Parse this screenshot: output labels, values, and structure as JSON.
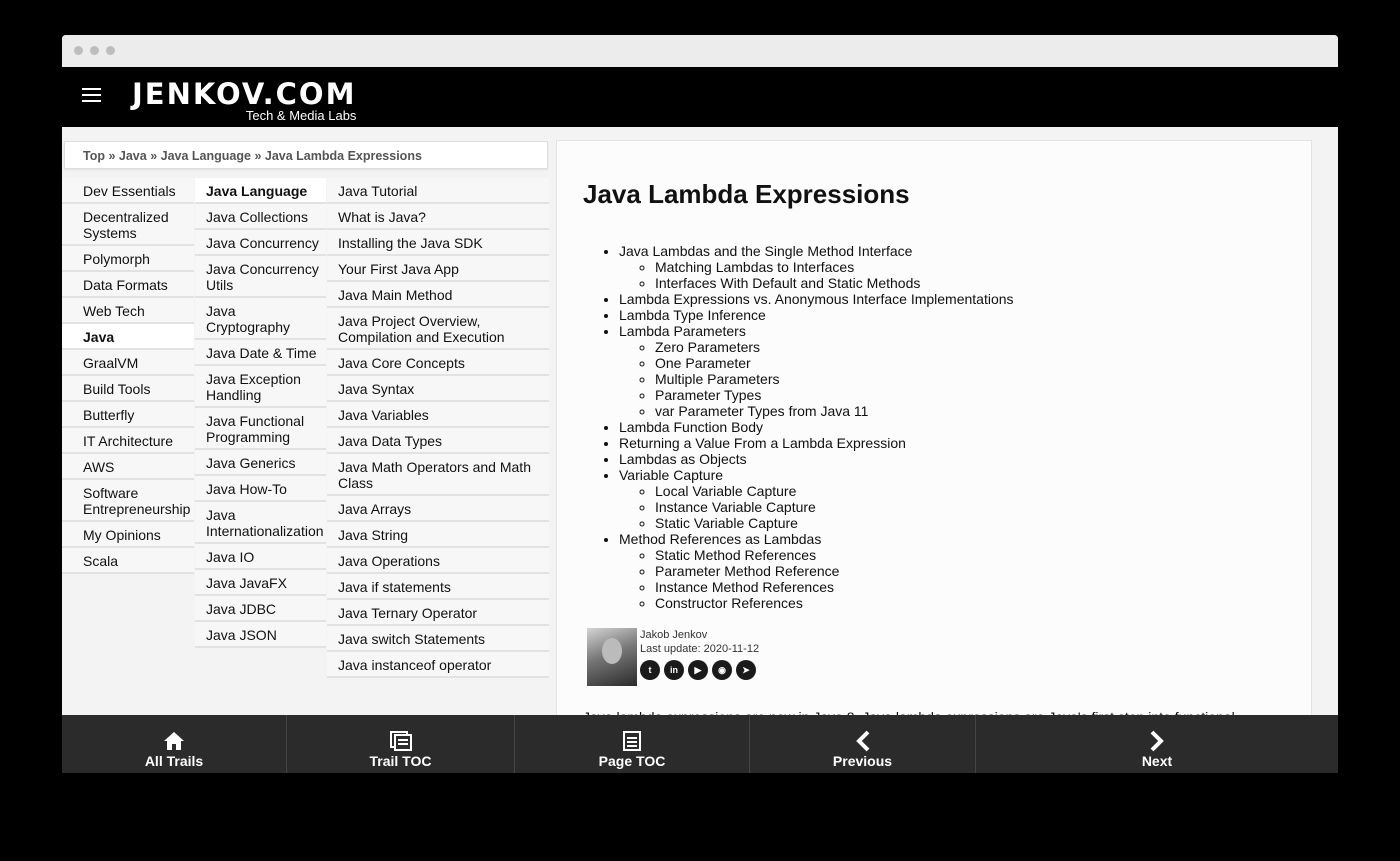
{
  "header": {
    "logo_main": "JENKOV.COM",
    "logo_sub": "Tech & Media Labs"
  },
  "breadcrumb": [
    "Top",
    "Java",
    "Java Language",
    "Java Lambda Expressions"
  ],
  "nav": {
    "col1": [
      "Dev Essentials",
      "Decentralized Systems",
      "Polymorph",
      "Data Formats",
      "Web Tech",
      "Java",
      "GraalVM",
      "Build Tools",
      "Butterfly",
      "IT Architecture",
      "AWS",
      "Software Entrepreneurship",
      "My Opinions",
      "Scala"
    ],
    "col1_active": 5,
    "col2": [
      "Java Language",
      "Java Collections",
      "Java Concurrency",
      "Java Concurrency Utils",
      "Java Cryptography",
      "Java Date & Time",
      "Java Exception Handling",
      "Java Functional Programming",
      "Java Generics",
      "Java How-To",
      "Java Internationalization",
      "Java IO",
      "Java JavaFX",
      "Java JDBC",
      "Java JSON"
    ],
    "col2_active": 0,
    "col3": [
      "Java Tutorial",
      "What is Java?",
      "Installing the Java SDK",
      "Your First Java App",
      "Java Main Method",
      "Java Project Overview, Compilation and Execution",
      "Java Core Concepts",
      "Java Syntax",
      "Java Variables",
      "Java Data Types",
      "Java Math Operators and Math Class",
      "Java Arrays",
      "Java String",
      "Java Operations",
      "Java if statements",
      "Java Ternary Operator",
      "Java switch Statements",
      "Java instanceof operator"
    ]
  },
  "article": {
    "title": "Java Lambda Expressions",
    "toc": [
      {
        "label": "Java Lambdas and the Single Method Interface",
        "children": [
          "Matching Lambdas to Interfaces",
          "Interfaces With Default and Static Methods"
        ]
      },
      {
        "label": "Lambda Expressions vs. Anonymous Interface Implementations",
        "children": []
      },
      {
        "label": "Lambda Type Inference",
        "children": []
      },
      {
        "label": "Lambda Parameters",
        "children": [
          "Zero Parameters",
          "One Parameter",
          "Multiple Parameters",
          "Parameter Types",
          "var Parameter Types from Java 11"
        ]
      },
      {
        "label": "Lambda Function Body",
        "children": []
      },
      {
        "label": "Returning a Value From a Lambda Expression",
        "children": []
      },
      {
        "label": "Lambdas as Objects",
        "children": []
      },
      {
        "label": "Variable Capture",
        "children": [
          "Local Variable Capture",
          "Instance Variable Capture",
          "Static Variable Capture"
        ]
      },
      {
        "label": "Method References as Lambdas",
        "children": [
          "Static Method References",
          "Parameter Method Reference",
          "Instance Method References",
          "Constructor References"
        ]
      }
    ],
    "author": {
      "name": "Jakob Jenkov",
      "last_update": "Last update: 2020-11-12"
    },
    "socials": [
      {
        "icon": "twitter-icon",
        "glyph": "t"
      },
      {
        "icon": "linkedin-icon",
        "glyph": "in"
      },
      {
        "icon": "youtube-icon",
        "glyph": "▶"
      },
      {
        "icon": "rss-icon",
        "glyph": "◉"
      },
      {
        "icon": "telegram-icon",
        "glyph": "➤"
      }
    ],
    "intro": "Java lambda expressions are new in Java 8. Java lambda expressions are Java's first step into functional"
  },
  "bottombar": {
    "all_trails": "All Trails",
    "trail_toc": "Trail TOC",
    "page_toc": "Page TOC",
    "previous": "Previous",
    "next": "Next"
  }
}
